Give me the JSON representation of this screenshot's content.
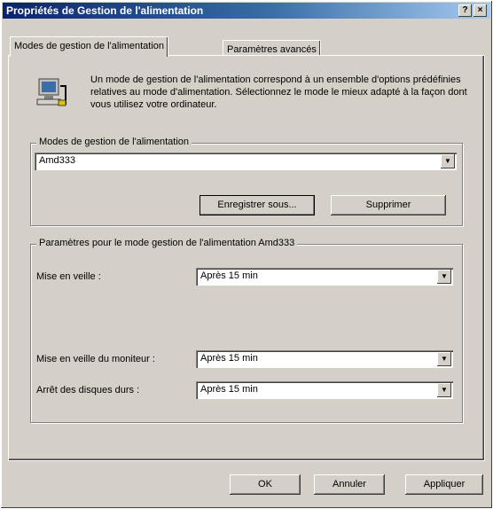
{
  "window": {
    "title": "Propriétés de Gestion de l'alimentation",
    "help_label": "?",
    "close_label": "×"
  },
  "tabs": [
    {
      "label": "Modes de gestion de l'alimentation"
    },
    {
      "label": "Paramètres avancés"
    }
  ],
  "intro": {
    "icon": "power-settings-computer-icon",
    "text": "Un mode de gestion de l'alimentation correspond à un ensemble d'options prédéfinies relatives au mode d'alimentation. Sélectionnez le mode le mieux adapté à la façon dont vous utilisez votre ordinateur."
  },
  "modes_group": {
    "title": "Modes de gestion de l'alimentation",
    "selected": "Amd333",
    "save_as_label": "Enregistrer sous...",
    "delete_label": "Supprimer"
  },
  "settings_group": {
    "title": "Paramètres pour le mode gestion de l'alimentation Amd333",
    "rows": [
      {
        "label": "Mise en veille :",
        "value": "Après 15 min"
      },
      {
        "label": "Mise en veille du moniteur :",
        "value": "Après 15 min"
      },
      {
        "label": "Arrêt des disques durs :",
        "value": "Après 15 min"
      }
    ]
  },
  "footer": {
    "ok_label": "OK",
    "cancel_label": "Annuler",
    "apply_label": "Appliquer"
  },
  "colors": {
    "face": "#d4d0c8",
    "titlebar_start": "#0a246a",
    "titlebar_end": "#a6caf0"
  }
}
